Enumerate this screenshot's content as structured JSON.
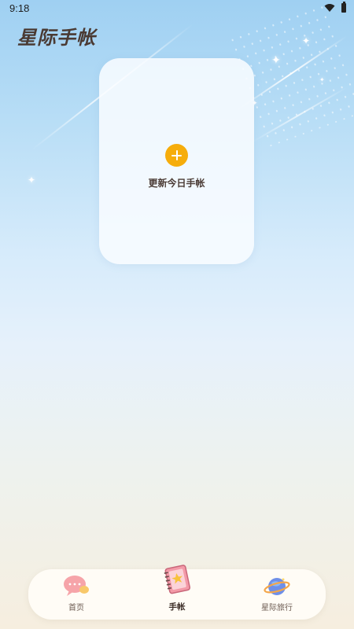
{
  "status_bar": {
    "time": "9:18"
  },
  "app": {
    "title": "星际手帐"
  },
  "card": {
    "label": "更新今日手帐"
  },
  "nav": {
    "items": [
      {
        "label": "首页",
        "icon": "chat-bubble-icon"
      },
      {
        "label": "手帐",
        "icon": "notebook-icon",
        "active": true
      },
      {
        "label": "星际旅行",
        "icon": "planet-icon"
      }
    ]
  },
  "colors": {
    "accent": "#f6ad0b",
    "title": "#4a3a33"
  }
}
